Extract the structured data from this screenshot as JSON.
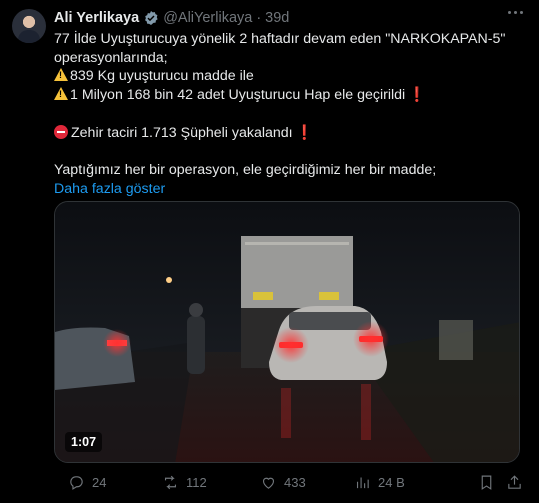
{
  "author": {
    "name": "Ali Yerlikaya",
    "handle": "@AliYerlikaya",
    "separator": "·",
    "time": "39d"
  },
  "tweet": {
    "line1": "77 İlde Uyuşturucuya yönelik 2 haftadır devam eden \"NARKOKAPAN-5\"",
    "line2": "operasyonlarında;",
    "line3": "839 Kg uyuşturucu madde ile",
    "line4": "1 Milyon 168 bin 42 adet Uyuşturucu Hap ele geçirildi",
    "line5": "Zehir taciri 1.713 Şüpheli yakalandı",
    "line6": "Yaptığımız her bir operasyon, ele geçirdiğimiz her bir madde;",
    "exclaim": "❗",
    "show_more": "Daha fazla göster"
  },
  "media": {
    "duration": "1:07"
  },
  "actions": {
    "replies": "24",
    "reposts": "112",
    "likes": "433",
    "views": "24 B"
  },
  "icons": {
    "verified": "verified-badge-icon",
    "more": "more-dots-icon",
    "warning": "warning-icon",
    "no_entry": "no-entry-icon",
    "reply": "reply-icon",
    "repost": "repost-icon",
    "like": "heart-icon",
    "views": "views-chart-icon",
    "bookmark": "bookmark-icon",
    "share": "share-icon"
  },
  "colors": {
    "background": "#000000",
    "text": "#e7e9ea",
    "muted": "#71767b",
    "link": "#1d9bf0",
    "verified": "#829aab",
    "warning": "#f6c23a",
    "alert": "#f4212e"
  }
}
